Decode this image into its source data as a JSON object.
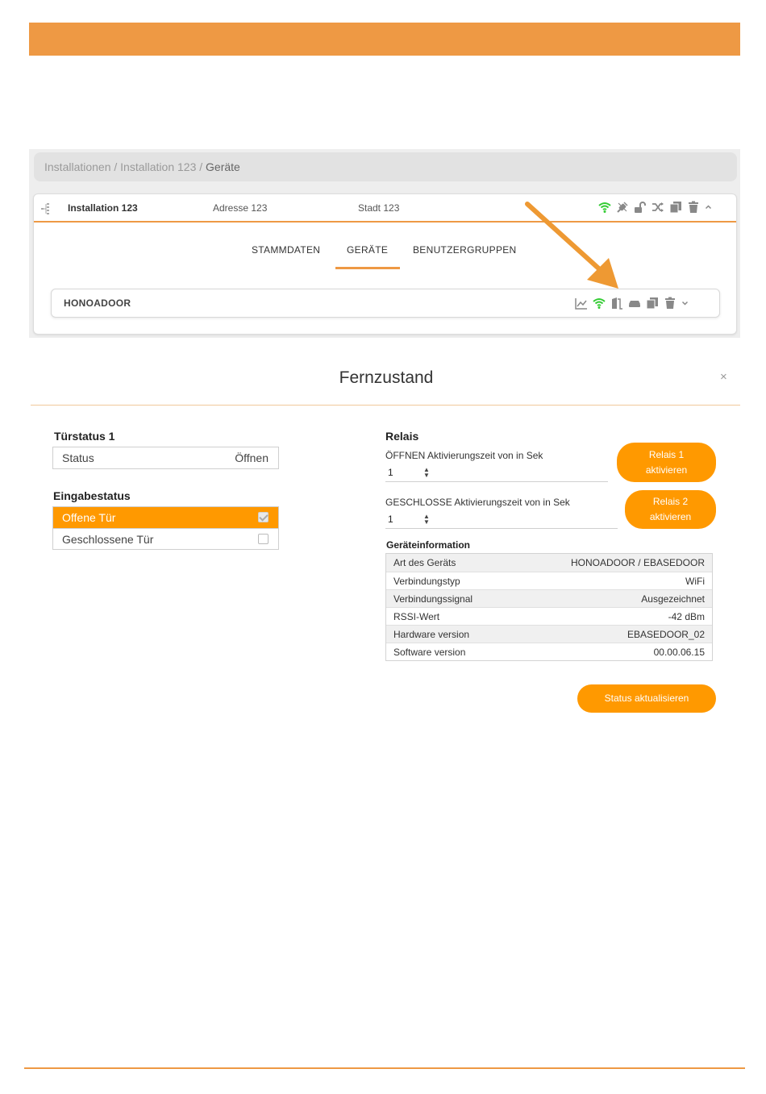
{
  "colors": {
    "accent": "#ee9944",
    "button": "#ff9900",
    "wifi": "#33cc33",
    "icon_grey": "#888888"
  },
  "breadcrumb": {
    "part1": "Installationen / Installation 123 / ",
    "current": "Geräte"
  },
  "installation": {
    "name": "Installation 123",
    "address": "Adresse 123",
    "city": "Stadt 123"
  },
  "tabs": [
    {
      "label": "STAMMDATEN",
      "active": false
    },
    {
      "label": "GERÄTE",
      "active": true
    },
    {
      "label": "BENUTZERGRUPPEN",
      "active": false
    }
  ],
  "device": {
    "name": "HONOADOOR"
  },
  "installation_icons": [
    "wifi-icon",
    "plug-icon",
    "unlock-icon",
    "shuffle-icon",
    "copy-icon",
    "trash-icon",
    "chevron-up-icon"
  ],
  "device_icons": [
    "chart-icon",
    "wifi-icon",
    "door-icon",
    "hdd-icon",
    "copy-icon",
    "trash-icon",
    "chevron-down-icon"
  ],
  "modal": {
    "title": "Fernzustand",
    "close": "×",
    "door_status": {
      "heading": "Türstatus 1",
      "rows": [
        {
          "label": "Status",
          "value": "Öffnen"
        }
      ]
    },
    "input_status": {
      "heading": "Eingabestatus",
      "rows": [
        {
          "label": "Offene Tür",
          "checked": true
        },
        {
          "label": "Geschlossene Tür",
          "checked": false
        }
      ]
    },
    "relay": {
      "heading": "Relais",
      "open_label": "ÖFFNEN Aktivierungszeit von in Sek",
      "open_value": "1",
      "relay1_line1": "Relais 1",
      "relay1_line2": "aktivieren",
      "close_label": "GESCHLOSSE Aktivierungszeit von in Sek",
      "close_value": "1",
      "relay2_line1": "Relais 2",
      "relay2_line2": "aktivieren"
    },
    "device_info": {
      "heading": "Geräteinformation",
      "rows": [
        {
          "label": "Art des Geräts",
          "value": "HONOADOOR / EBASEDOOR"
        },
        {
          "label": "Verbindungstyp",
          "value": "WiFi"
        },
        {
          "label": "Verbindungssignal",
          "value": "Ausgezeichnet"
        },
        {
          "label": "RSSI-Wert",
          "value": "-42 dBm"
        },
        {
          "label": "Hardware version",
          "value": "EBASEDOOR_02"
        },
        {
          "label": "Software version",
          "value": "00.00.06.15"
        }
      ]
    },
    "refresh_button": "Status aktualisieren"
  }
}
